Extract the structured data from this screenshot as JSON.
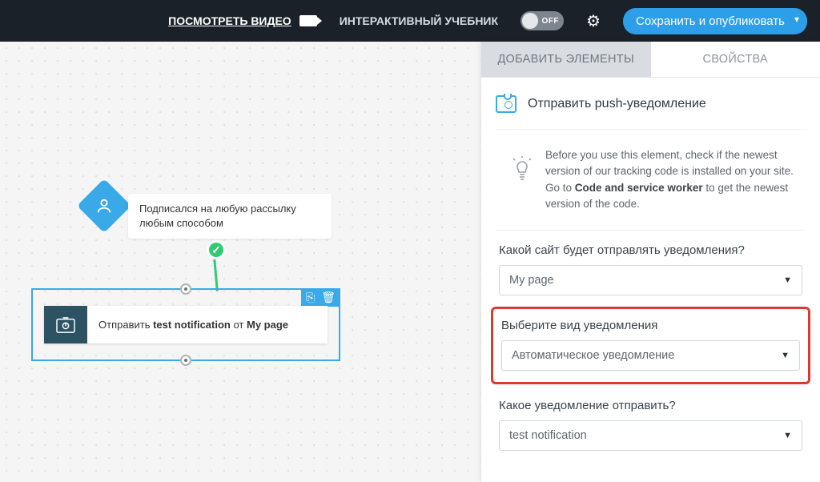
{
  "header": {
    "video_link": "ПОСМОТРЕТЬ ВИДЕО",
    "tutorial_label": "ИНТЕРАКТИВНЫЙ УЧЕБНИК",
    "toggle_state": "OFF",
    "save_button": "Сохранить и опубликовать"
  },
  "canvas": {
    "trigger": {
      "text": "Подписался на любую рассылку любым способом"
    },
    "action": {
      "prefix": "Отправить ",
      "notification": "test notification",
      "middle": " от ",
      "page": "My page"
    }
  },
  "panel": {
    "tabs": {
      "add": "ДОБАВИТЬ ЭЛЕМЕНТЫ",
      "props": "СВОЙСТВА"
    },
    "title": "Отправить push-уведомление",
    "info": {
      "pre": "Before you use this element, check if the newest version of our tracking code is installed on your site. Go to ",
      "bold": "Code and service worker",
      "post": " to get the newest version of the code."
    },
    "fields": {
      "site_label": "Какой сайт будет отправлять уведомления?",
      "site_value": "My page",
      "type_label": "Выберите вид уведомления",
      "type_value": "Автоматическое уведомление",
      "notif_label": "Какое уведомление отправить?",
      "notif_value": "test notification"
    }
  }
}
